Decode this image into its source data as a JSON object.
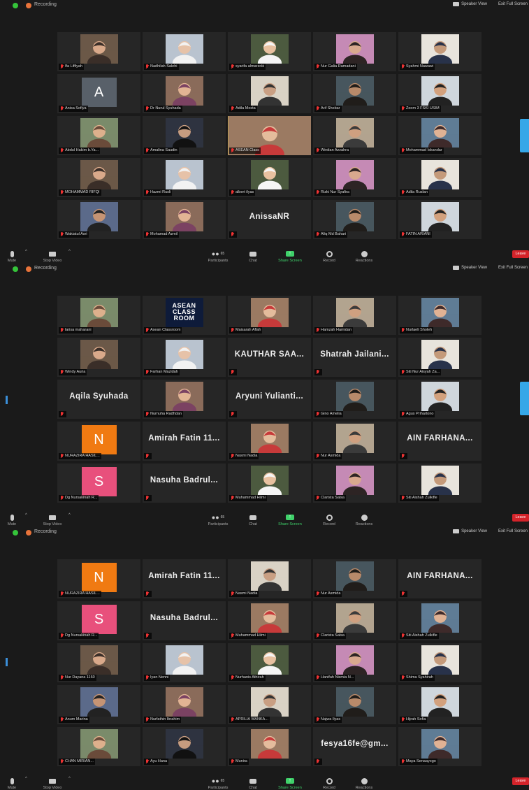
{
  "header": {
    "recording_label": "Recording",
    "speaker_view_label": "Speaker View",
    "fullscreen_label": "Exit Full Screen"
  },
  "toolbar": {
    "mute_label": "Mute",
    "stop_video_label": "Stop Video",
    "participants_label": "Participants",
    "participants_count": "65",
    "chat_label": "Chat",
    "share_screen_label": "Share Screen",
    "record_label": "Record",
    "reactions_label": "Reactions",
    "leave_label": "Leave"
  },
  "colors": {
    "background": "#1a1a1a",
    "tile": "#262626",
    "active_speaker": "#e2c443",
    "share_green": "#3fd16a",
    "leave_red": "#d4232a",
    "mute_red": "#ee3333"
  },
  "panels": [
    {
      "tiles": [
        {
          "label": "Ifa Liffiyah",
          "kind": "photo"
        },
        {
          "label": "Nadhilah Salehi",
          "kind": "photo"
        },
        {
          "label": "syarifa almarzoki",
          "kind": "photo"
        },
        {
          "label": "Nur Galia Ramadani",
          "kind": "photo"
        },
        {
          "label": "Syahmi Nawawi",
          "kind": "photo"
        },
        {
          "label": "Anisa Sofiya",
          "kind": "letter",
          "letter": "A",
          "color": "#586069"
        },
        {
          "label": "Dr Nurul Syuhada",
          "kind": "photo"
        },
        {
          "label": "Adila Mosta",
          "kind": "photo"
        },
        {
          "label": "Arif Shobar",
          "kind": "photo"
        },
        {
          "label": "Zoom 3 FSKI USIM",
          "kind": "photo"
        },
        {
          "label": "Abdul Hakim b.Ya...",
          "kind": "photo"
        },
        {
          "label": "Amalina Saudin",
          "kind": "photo"
        },
        {
          "label": "ASEAN Class",
          "kind": "photo",
          "active": true
        },
        {
          "label": "Wirdian Azzahra",
          "kind": "photo"
        },
        {
          "label": "Mohammad Iskandar",
          "kind": "photo"
        },
        {
          "label": "MOHAMMAD RIFQI",
          "kind": "photo"
        },
        {
          "label": "Hazmi Rusli",
          "kind": "photo"
        },
        {
          "label": "albert ilyas",
          "kind": "photo"
        },
        {
          "label": "Rizki Nur Syafira",
          "kind": "photo"
        },
        {
          "label": "Adila Ruslan",
          "kind": "photo"
        },
        {
          "label": "Wakiatul Asri",
          "kind": "photo"
        },
        {
          "label": "Mohamad Azmil",
          "kind": "photo"
        },
        {
          "label": "",
          "kind": "name",
          "name": "AnissaNR"
        },
        {
          "label": "Afiq Md Bahari",
          "kind": "photo"
        },
        {
          "label": "FATIN ARIANI",
          "kind": "photo"
        }
      ]
    },
    {
      "tiles": [
        {
          "label": "larisa maharani",
          "kind": "photo"
        },
        {
          "label": "Asean Classroom",
          "kind": "asean",
          "text": "ASEAN CLASS ROOM"
        },
        {
          "label": "Maisarah Aflah",
          "kind": "photo"
        },
        {
          "label": "Hamzah Hamidan",
          "kind": "photo"
        },
        {
          "label": "Nurlaeli Sholeh",
          "kind": "photo"
        },
        {
          "label": "Windy Auria",
          "kind": "photo"
        },
        {
          "label": "Farhan Mazidah",
          "kind": "photo"
        },
        {
          "label": "",
          "kind": "name",
          "name": "KAUTHAR SAA..."
        },
        {
          "label": "",
          "kind": "name",
          "name": "Shatrah Jailani..."
        },
        {
          "label": "Siti Nur Aisyah Za...",
          "kind": "photo"
        },
        {
          "label": "",
          "kind": "name",
          "name": "Aqila Syuhada"
        },
        {
          "label": "Nurnuha Radhdan",
          "kind": "photo"
        },
        {
          "label": "",
          "kind": "name",
          "name": "Aryuni Yulianti..."
        },
        {
          "label": "Gino Amelia",
          "kind": "photo"
        },
        {
          "label": "Agus Prihartono",
          "kind": "photo"
        },
        {
          "label": "NURAZIRA HASIL...",
          "kind": "letter",
          "letter": "N",
          "color": "#f07a12"
        },
        {
          "label": "",
          "kind": "name",
          "name": "Amirah Fatin 11..."
        },
        {
          "label": "Nasmi Nadia",
          "kind": "photo"
        },
        {
          "label": "Nur Asmida",
          "kind": "photo"
        },
        {
          "label": "",
          "kind": "name",
          "name": "AIN FARHANA..."
        },
        {
          "label": "Dg Nursakinah R...",
          "kind": "letter",
          "letter": "S",
          "color": "#e8507c"
        },
        {
          "label": "",
          "kind": "name",
          "name": "Nasuha Badrul..."
        },
        {
          "label": "Muhammad Hilmi",
          "kind": "photo"
        },
        {
          "label": "Clarista Salsa",
          "kind": "photo"
        },
        {
          "label": "Siti Aishah Zulkifle",
          "kind": "photo"
        }
      ]
    },
    {
      "tiles": [
        {
          "label": "NURAZIRA HASIL...",
          "kind": "letter",
          "letter": "N",
          "color": "#f07a12"
        },
        {
          "label": "",
          "kind": "name",
          "name": "Amirah Fatin 11..."
        },
        {
          "label": "Nasmi Nadia",
          "kind": "photo"
        },
        {
          "label": "Nur Asmida",
          "kind": "photo"
        },
        {
          "label": "",
          "kind": "name",
          "name": "AIN FARHANA..."
        },
        {
          "label": "Dg Nursakinah R...",
          "kind": "letter",
          "letter": "S",
          "color": "#e8507c"
        },
        {
          "label": "",
          "kind": "name",
          "name": "Nasuha Badrul..."
        },
        {
          "label": "Muhammad Hilmi",
          "kind": "photo"
        },
        {
          "label": "Clarista Salsa",
          "kind": "photo"
        },
        {
          "label": "Siti Aishah Zulkifle",
          "kind": "photo"
        },
        {
          "label": "Nur Dayana 1160",
          "kind": "photo"
        },
        {
          "label": "Iyan Nenni",
          "kind": "photo"
        },
        {
          "label": "Nurhanis Athirah",
          "kind": "photo"
        },
        {
          "label": "Hanifah Nismia N...",
          "kind": "photo"
        },
        {
          "label": "Shima Syahirah",
          "kind": "photo"
        },
        {
          "label": "Anum Marina",
          "kind": "photo"
        },
        {
          "label": "Nurfathin Ibrahim",
          "kind": "photo"
        },
        {
          "label": "APRILIA WANKA...",
          "kind": "photo"
        },
        {
          "label": "Najwa Ilyas",
          "kind": "photo"
        },
        {
          "label": "Hijrah Sofia",
          "kind": "photo"
        },
        {
          "label": "CHAN MIRIAN...",
          "kind": "photo"
        },
        {
          "label": "Ayu Hana",
          "kind": "photo"
        },
        {
          "label": "Munira",
          "kind": "photo"
        },
        {
          "label": "",
          "kind": "name",
          "name": "fesya16fe@gm..."
        },
        {
          "label": "Maya Senaayogo",
          "kind": "photo"
        }
      ]
    }
  ]
}
